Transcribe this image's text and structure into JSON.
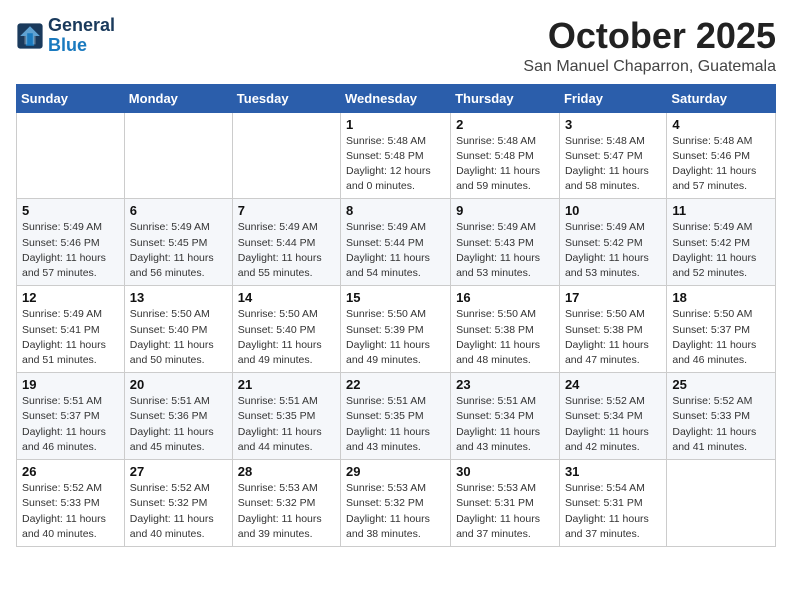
{
  "logo": {
    "line1": "General",
    "line2": "Blue"
  },
  "title": "October 2025",
  "location": "San Manuel Chaparron, Guatemala",
  "weekdays": [
    "Sunday",
    "Monday",
    "Tuesday",
    "Wednesday",
    "Thursday",
    "Friday",
    "Saturday"
  ],
  "weeks": [
    [
      {
        "day": "",
        "sunrise": "",
        "sunset": "",
        "daylight": ""
      },
      {
        "day": "",
        "sunrise": "",
        "sunset": "",
        "daylight": ""
      },
      {
        "day": "",
        "sunrise": "",
        "sunset": "",
        "daylight": ""
      },
      {
        "day": "1",
        "sunrise": "Sunrise: 5:48 AM",
        "sunset": "Sunset: 5:48 PM",
        "daylight": "Daylight: 12 hours and 0 minutes."
      },
      {
        "day": "2",
        "sunrise": "Sunrise: 5:48 AM",
        "sunset": "Sunset: 5:48 PM",
        "daylight": "Daylight: 11 hours and 59 minutes."
      },
      {
        "day": "3",
        "sunrise": "Sunrise: 5:48 AM",
        "sunset": "Sunset: 5:47 PM",
        "daylight": "Daylight: 11 hours and 58 minutes."
      },
      {
        "day": "4",
        "sunrise": "Sunrise: 5:48 AM",
        "sunset": "Sunset: 5:46 PM",
        "daylight": "Daylight: 11 hours and 57 minutes."
      }
    ],
    [
      {
        "day": "5",
        "sunrise": "Sunrise: 5:49 AM",
        "sunset": "Sunset: 5:46 PM",
        "daylight": "Daylight: 11 hours and 57 minutes."
      },
      {
        "day": "6",
        "sunrise": "Sunrise: 5:49 AM",
        "sunset": "Sunset: 5:45 PM",
        "daylight": "Daylight: 11 hours and 56 minutes."
      },
      {
        "day": "7",
        "sunrise": "Sunrise: 5:49 AM",
        "sunset": "Sunset: 5:44 PM",
        "daylight": "Daylight: 11 hours and 55 minutes."
      },
      {
        "day": "8",
        "sunrise": "Sunrise: 5:49 AM",
        "sunset": "Sunset: 5:44 PM",
        "daylight": "Daylight: 11 hours and 54 minutes."
      },
      {
        "day": "9",
        "sunrise": "Sunrise: 5:49 AM",
        "sunset": "Sunset: 5:43 PM",
        "daylight": "Daylight: 11 hours and 53 minutes."
      },
      {
        "day": "10",
        "sunrise": "Sunrise: 5:49 AM",
        "sunset": "Sunset: 5:42 PM",
        "daylight": "Daylight: 11 hours and 53 minutes."
      },
      {
        "day": "11",
        "sunrise": "Sunrise: 5:49 AM",
        "sunset": "Sunset: 5:42 PM",
        "daylight": "Daylight: 11 hours and 52 minutes."
      }
    ],
    [
      {
        "day": "12",
        "sunrise": "Sunrise: 5:49 AM",
        "sunset": "Sunset: 5:41 PM",
        "daylight": "Daylight: 11 hours and 51 minutes."
      },
      {
        "day": "13",
        "sunrise": "Sunrise: 5:50 AM",
        "sunset": "Sunset: 5:40 PM",
        "daylight": "Daylight: 11 hours and 50 minutes."
      },
      {
        "day": "14",
        "sunrise": "Sunrise: 5:50 AM",
        "sunset": "Sunset: 5:40 PM",
        "daylight": "Daylight: 11 hours and 49 minutes."
      },
      {
        "day": "15",
        "sunrise": "Sunrise: 5:50 AM",
        "sunset": "Sunset: 5:39 PM",
        "daylight": "Daylight: 11 hours and 49 minutes."
      },
      {
        "day": "16",
        "sunrise": "Sunrise: 5:50 AM",
        "sunset": "Sunset: 5:38 PM",
        "daylight": "Daylight: 11 hours and 48 minutes."
      },
      {
        "day": "17",
        "sunrise": "Sunrise: 5:50 AM",
        "sunset": "Sunset: 5:38 PM",
        "daylight": "Daylight: 11 hours and 47 minutes."
      },
      {
        "day": "18",
        "sunrise": "Sunrise: 5:50 AM",
        "sunset": "Sunset: 5:37 PM",
        "daylight": "Daylight: 11 hours and 46 minutes."
      }
    ],
    [
      {
        "day": "19",
        "sunrise": "Sunrise: 5:51 AM",
        "sunset": "Sunset: 5:37 PM",
        "daylight": "Daylight: 11 hours and 46 minutes."
      },
      {
        "day": "20",
        "sunrise": "Sunrise: 5:51 AM",
        "sunset": "Sunset: 5:36 PM",
        "daylight": "Daylight: 11 hours and 45 minutes."
      },
      {
        "day": "21",
        "sunrise": "Sunrise: 5:51 AM",
        "sunset": "Sunset: 5:35 PM",
        "daylight": "Daylight: 11 hours and 44 minutes."
      },
      {
        "day": "22",
        "sunrise": "Sunrise: 5:51 AM",
        "sunset": "Sunset: 5:35 PM",
        "daylight": "Daylight: 11 hours and 43 minutes."
      },
      {
        "day": "23",
        "sunrise": "Sunrise: 5:51 AM",
        "sunset": "Sunset: 5:34 PM",
        "daylight": "Daylight: 11 hours and 43 minutes."
      },
      {
        "day": "24",
        "sunrise": "Sunrise: 5:52 AM",
        "sunset": "Sunset: 5:34 PM",
        "daylight": "Daylight: 11 hours and 42 minutes."
      },
      {
        "day": "25",
        "sunrise": "Sunrise: 5:52 AM",
        "sunset": "Sunset: 5:33 PM",
        "daylight": "Daylight: 11 hours and 41 minutes."
      }
    ],
    [
      {
        "day": "26",
        "sunrise": "Sunrise: 5:52 AM",
        "sunset": "Sunset: 5:33 PM",
        "daylight": "Daylight: 11 hours and 40 minutes."
      },
      {
        "day": "27",
        "sunrise": "Sunrise: 5:52 AM",
        "sunset": "Sunset: 5:32 PM",
        "daylight": "Daylight: 11 hours and 40 minutes."
      },
      {
        "day": "28",
        "sunrise": "Sunrise: 5:53 AM",
        "sunset": "Sunset: 5:32 PM",
        "daylight": "Daylight: 11 hours and 39 minutes."
      },
      {
        "day": "29",
        "sunrise": "Sunrise: 5:53 AM",
        "sunset": "Sunset: 5:32 PM",
        "daylight": "Daylight: 11 hours and 38 minutes."
      },
      {
        "day": "30",
        "sunrise": "Sunrise: 5:53 AM",
        "sunset": "Sunset: 5:31 PM",
        "daylight": "Daylight: 11 hours and 37 minutes."
      },
      {
        "day": "31",
        "sunrise": "Sunrise: 5:54 AM",
        "sunset": "Sunset: 5:31 PM",
        "daylight": "Daylight: 11 hours and 37 minutes."
      },
      {
        "day": "",
        "sunrise": "",
        "sunset": "",
        "daylight": ""
      }
    ]
  ]
}
